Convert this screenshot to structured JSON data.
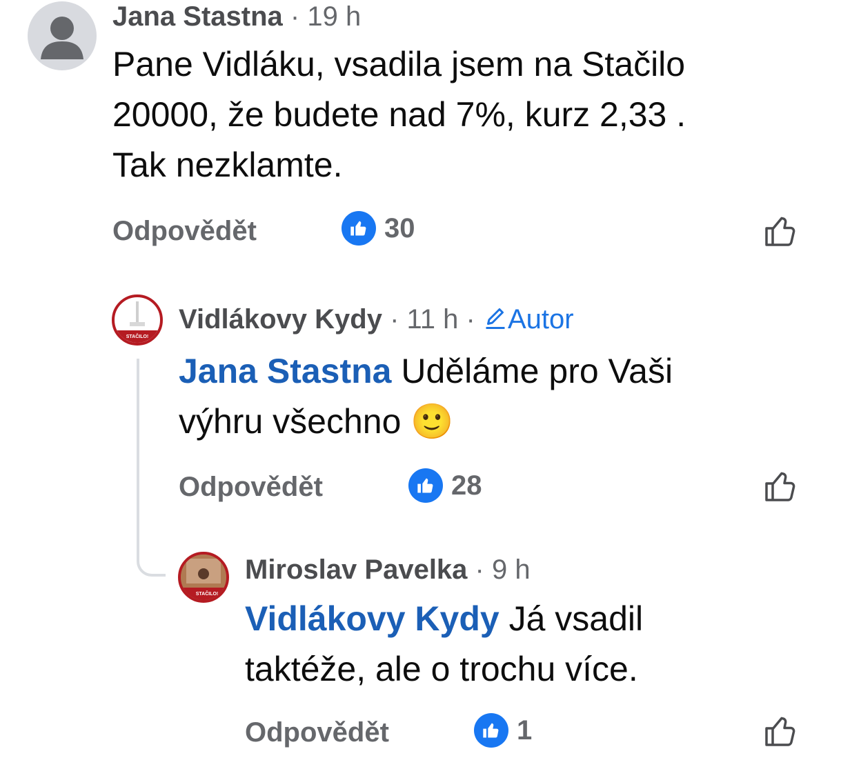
{
  "comments": [
    {
      "author": "Jana Stastna",
      "time": "· 19 h",
      "text_lines": [
        "Pane Vidláku, vsadila jsem na Stačilo",
        "20000, že budete nad 7%, kurz 2,33 .",
        "Tak nezklamte."
      ],
      "reply_label": "Odpovědět",
      "like_count": "30"
    },
    {
      "author": "Vidlákovy Kydy",
      "time": "· 11 h ·",
      "badge": "Autor",
      "mention": "Jana Stastna",
      "text_line1": "Uděláme pro Vaši",
      "text_line2": "výhru všechno",
      "emoji": "🙂",
      "reply_label": "Odpovědět",
      "like_count": "28"
    },
    {
      "author": "Miroslav Pavelka",
      "time": "· 9 h",
      "mention": "Vidlákovy Kydy",
      "text_line1": "Já vsadil",
      "text_line2": "taktéže, ale o trochu více.",
      "reply_label": "Odpovědět",
      "like_count": "1"
    }
  ],
  "avatar_logo_text": "STAČILO!",
  "icons": {
    "like_badge": "thumbs-up-icon",
    "like_button": "thumbs-up-outline-icon",
    "edit": "pencil-icon"
  },
  "colors": {
    "like_blue": "#1877f2",
    "mention_blue": "#1b5fb6",
    "brand_red": "#b51b22",
    "meta_gray": "#65676b"
  }
}
